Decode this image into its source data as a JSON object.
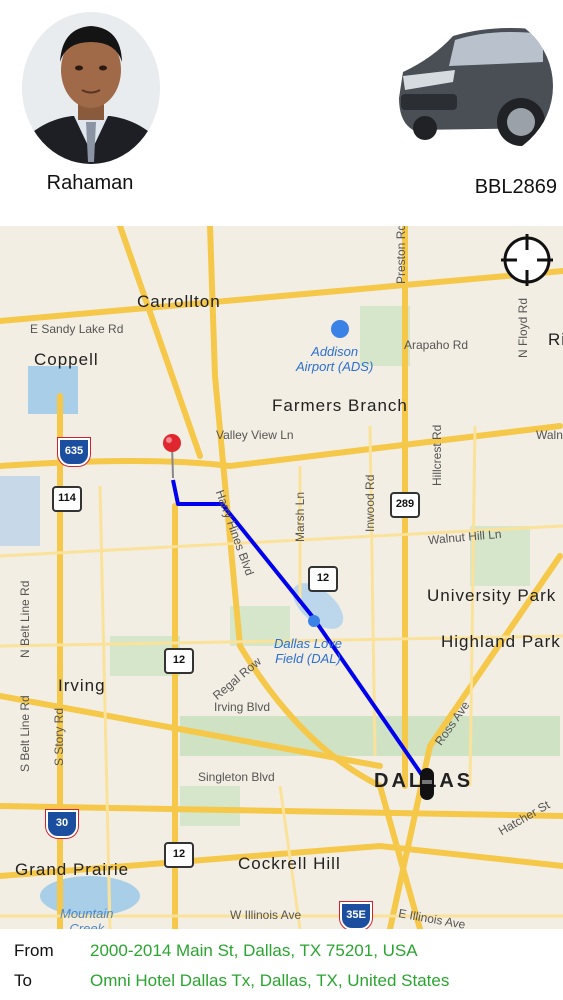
{
  "driver": {
    "name": "Rahaman",
    "photo_icon": "driver-avatar"
  },
  "vehicle": {
    "plate": "BBL2869",
    "photo_icon": "car-image"
  },
  "map": {
    "locate_icon": "crosshair-icon",
    "labels": {
      "carrollton": "Carrollton",
      "sandy_lake": "E Sandy Lake Rd",
      "coppell": "Coppell",
      "addison": "Addison\nAirport (ADS)",
      "arapaho": "Arapaho Rd",
      "preston": "Preston Rd",
      "floyd": "N Floyd Rd",
      "ri": "Ri",
      "farmers": "Farmers Branch",
      "valley": "Valley View Ln",
      "hillcrest": "Hillcrest Rd",
      "walnut_r": "Walnu",
      "hines": "Harry Hines Blvd",
      "marsh": "Marsh Ln",
      "inwood": "Inwood Rd",
      "walnut_hill": "Walnut Hill Ln",
      "university": "University Park",
      "love_field": "Dallas Love\nField (DAL)",
      "highland": "Highland Park",
      "beltline_n": "N Belt Line Rd",
      "regal": "Regal Row",
      "irving": "Irving",
      "irving_blvd": "Irving Blvd",
      "story": "S Story Rd",
      "beltline_s": "S Belt Line Rd",
      "ross": "Ross Ave",
      "singleton": "Singleton Blvd",
      "dallas": "DALLAS",
      "hatcher": "Hatcher St",
      "grand_prairie": "Grand Prairie",
      "cockrell": "Cockrell Hill",
      "mountain_creek": "Mountain\nCreek",
      "illinois_w": "W Illinois Ave",
      "illinois_e": "E Illinois Ave"
    },
    "shields": {
      "i635": "635",
      "s114": "114",
      "s289": "289",
      "s12a": "12",
      "s12b": "12",
      "s12c": "12",
      "i30": "30",
      "i35e": "35E"
    },
    "route_color": "#0000ee",
    "pin_color": "#e0262e"
  },
  "route": {
    "from_label": "From",
    "from_value": "2000-2014 Main St, Dallas, TX 75201, USA",
    "to_label": "To",
    "to_value": "Omni Hotel Dallas Tx, Dallas, TX, United States"
  }
}
